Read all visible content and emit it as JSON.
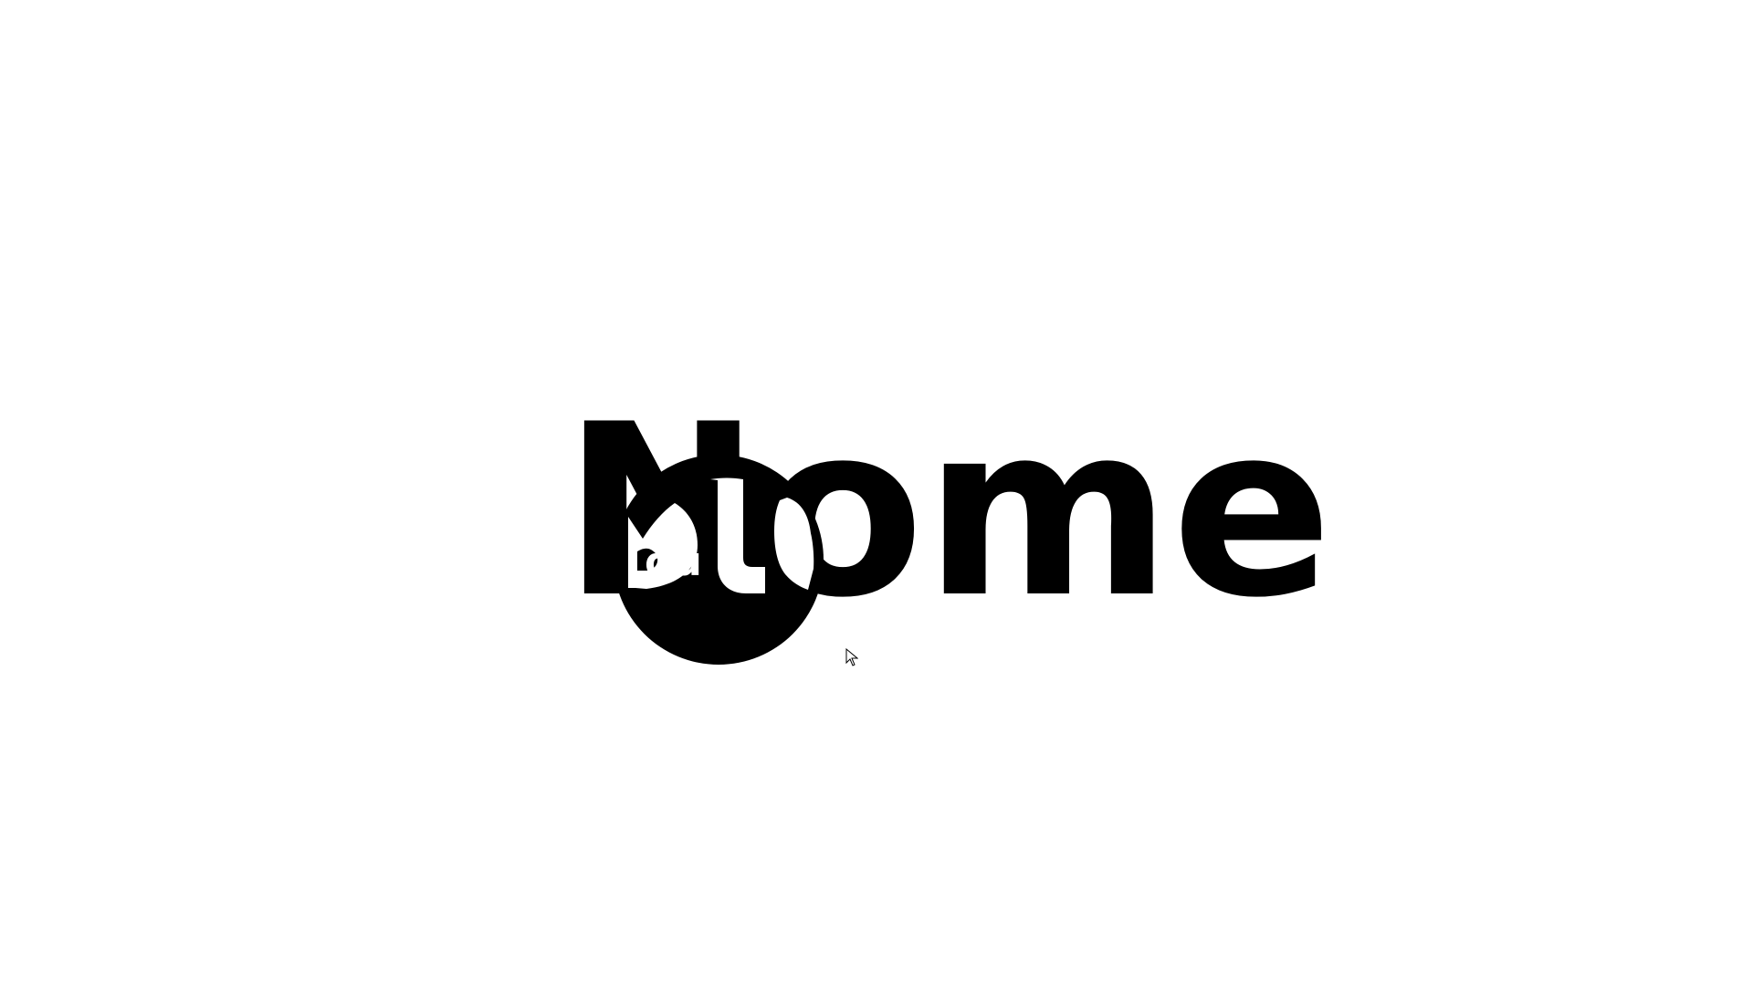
{
  "page": {
    "background": "#ffffff",
    "ink": "#000000",
    "accent": "#ffffff"
  },
  "logo": {
    "word": "Nome",
    "overlay_mark": "du",
    "icon": "circle-knockout-logo"
  },
  "cursor": {
    "icon": "mouse-pointer-icon"
  }
}
